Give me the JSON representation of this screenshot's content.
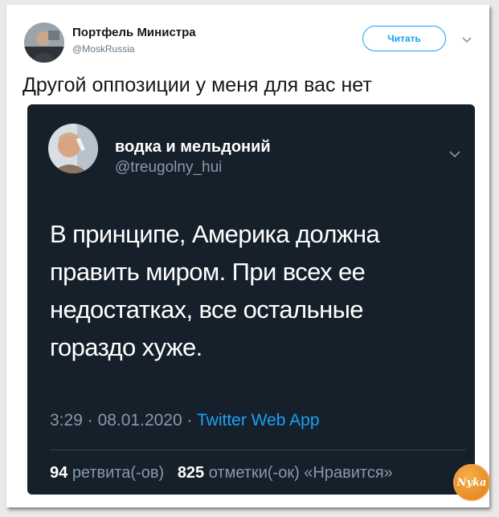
{
  "outer_tweet": {
    "author_name": "Портфель Министра",
    "author_handle": "@MoskRussia",
    "follow_label": "Читать",
    "text": "Другой оппозиции у меня для вас нет"
  },
  "quoted_tweet": {
    "author_name": "водка и мельдоний",
    "author_handle": "@treugolny_hui",
    "text": "В принципе, Америка должна править миром. При всех ее недостатках, все остальные гораздо хуже.",
    "time": "3:29",
    "date": "08.01.2020",
    "separator": "·",
    "source_app": "Twitter Web App",
    "retweet_count": "94",
    "retweet_label": "ретвита(-ов)",
    "like_count": "825",
    "like_label": "отметки(-ок) «Нравится»"
  },
  "watermark": {
    "text": "Nyka"
  },
  "colors": {
    "accent": "#1da1f2",
    "dark_bg": "#15202b",
    "muted": "#8899a6"
  }
}
